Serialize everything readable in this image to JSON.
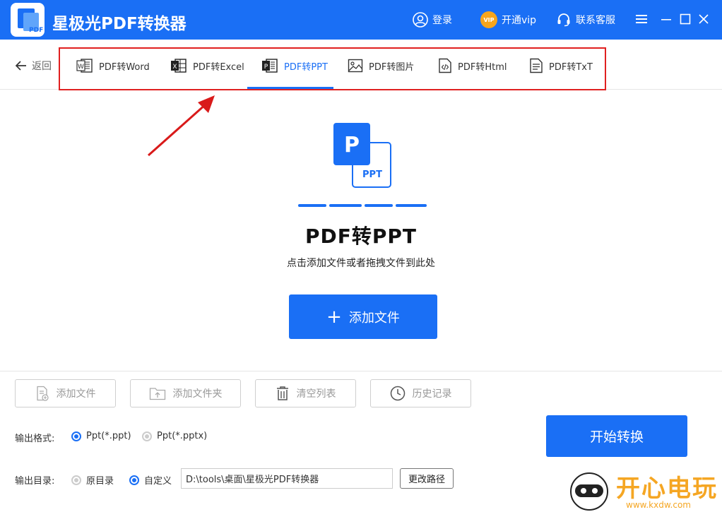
{
  "app": {
    "title": "星极光PDF转换器",
    "logo_text": "PDF"
  },
  "titlebar": {
    "login_label": "登录",
    "vip_badge": "VIP",
    "vip_label": "开通vip",
    "support_label": "联系客服"
  },
  "nav": {
    "back_label": "返回",
    "tabs": [
      {
        "label": "PDF转Word",
        "icon": "word-doc-icon",
        "icon_letter": "W"
      },
      {
        "label": "PDF转Excel",
        "icon": "excel-doc-icon",
        "icon_letter": "X"
      },
      {
        "label": "PDF转PPT",
        "icon": "ppt-doc-icon",
        "icon_letter": "P",
        "active": true
      },
      {
        "label": "PDF转图片",
        "icon": "image-icon"
      },
      {
        "label": "PDF转Html",
        "icon": "html-code-icon"
      },
      {
        "label": "PDF转TxT",
        "icon": "txt-doc-icon"
      }
    ]
  },
  "hero": {
    "icon_letter": "P",
    "icon_tag": "PPT",
    "title": "PDF转PPT",
    "subtitle": "点击添加文件或者拖拽文件到此处",
    "add_button": "添加文件"
  },
  "toolbar": {
    "add_file": "添加文件",
    "add_folder": "添加文件夹",
    "clear_list": "清空列表",
    "history": "历史记录"
  },
  "output": {
    "format_label": "输出格式:",
    "format_options": [
      "Ppt(*.ppt)",
      "Ppt(*.pptx)"
    ],
    "format_selected": 0,
    "dir_label": "输出目录:",
    "dir_options": [
      "原目录",
      "自定义"
    ],
    "dir_selected": 1,
    "dir_path": "D:\\tools\\桌面\\星极光PDF转换器",
    "change_path": "更改路径"
  },
  "start_button": "开始转换",
  "watermark": {
    "text": "开心电玩",
    "url": "www.kxdw.com"
  },
  "colors": {
    "primary": "#1a6ff5",
    "highlight": "#e02020",
    "watermark": "#f5a623"
  }
}
